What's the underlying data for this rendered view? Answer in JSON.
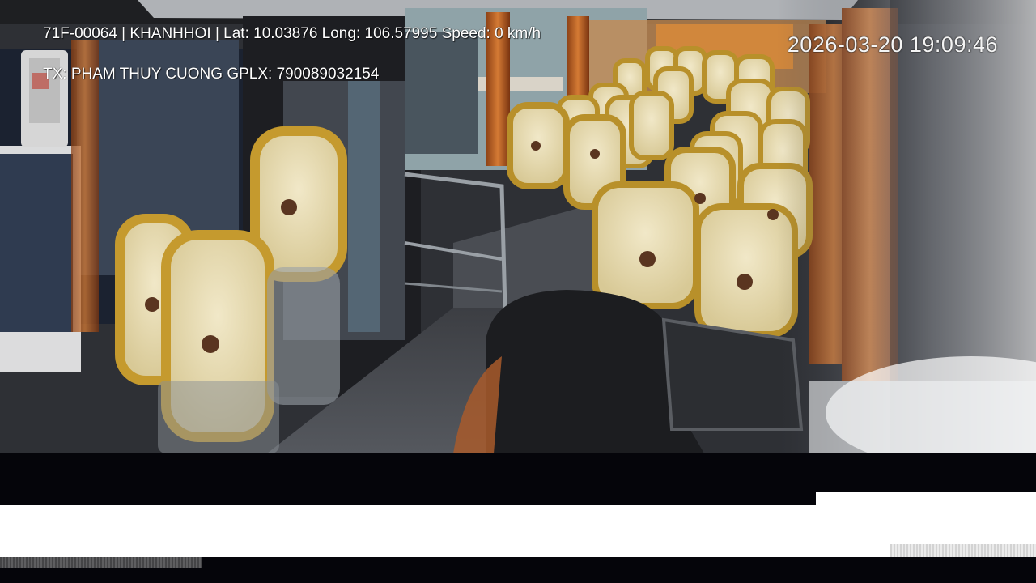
{
  "osd": {
    "line1": "71F-00064 | KHANHHOI | Lat: 10.03876 Long: 106.57995 Speed: 0 km/h",
    "line2": "TX: PHAM THUY CUONG GPLX: 790089032154",
    "timestamp": "2026-03-20 19:09:46"
  },
  "colors": {
    "seat_cover": "#e8dcb4",
    "seat_trim": "#b8902a",
    "curtain": "#c86a2a",
    "interior": "#2b2d31",
    "osd_text": "#ffffff"
  }
}
